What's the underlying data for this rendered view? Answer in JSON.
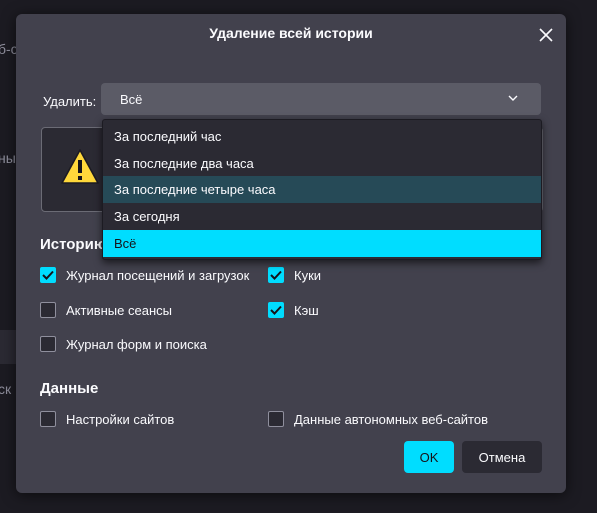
{
  "background": {
    "fragments": [
      "б-с",
      "ны",
      "ск"
    ]
  },
  "dialog": {
    "title": "Удаление всей истории",
    "delete_label": "Удалить:",
    "range_value": "Всё",
    "history_section": "Историю",
    "data_section": "Данные",
    "buttons": {
      "ok": "OK",
      "cancel": "Отмена"
    }
  },
  "history_items": [
    {
      "label": "Журнал посещений и загрузок",
      "checked": true
    },
    {
      "label": "Куки",
      "checked": true
    },
    {
      "label": "Активные сеансы",
      "checked": false
    },
    {
      "label": "Кэш",
      "checked": true
    },
    {
      "label": "Журнал форм и поиска",
      "checked": false
    }
  ],
  "data_items": [
    {
      "label": "Настройки сайтов",
      "checked": false
    },
    {
      "label": "Данные автономных веб-сайтов",
      "checked": false
    }
  ],
  "dropdown": {
    "options": [
      "За последний час",
      "За последние два часа",
      "За последние четыре часа",
      "За сегодня",
      "Всё"
    ],
    "hovered": "За последние четыре часа",
    "selected": "Всё"
  },
  "colors": {
    "accent": "#00ddff",
    "dialog_bg": "#42414d",
    "hover": "#264a57"
  },
  "icons": [
    "close-icon",
    "chevron-down-icon",
    "warning-icon",
    "checkmark-icon"
  ]
}
